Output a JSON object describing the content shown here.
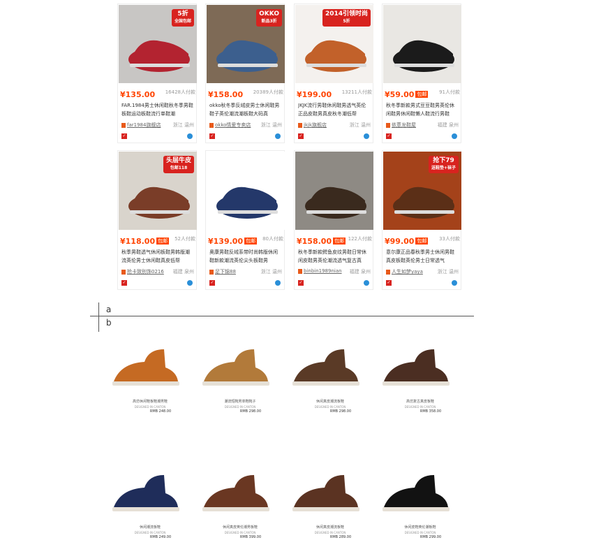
{
  "products": [
    {
      "price": "¥135.00",
      "sold": "16428人付款",
      "badge": "",
      "title": "FAR.1984男士休闲鞋秋冬季男鞋板鞋运动板鞋流行单鞋潮",
      "shop": "far1984旗舰店",
      "loc": "浙江 温州",
      "overlay": "5折",
      "overlay_sub": "全国包邮"
    },
    {
      "price": "¥158.00",
      "sold": "20389人付款",
      "badge": "",
      "title": "okko秋冬季反绒皮男士休闲鞋男鞋子英伦潮流潮板鞋大码真",
      "shop": "okko情爱专卖店",
      "loc": "浙江 温州",
      "overlay": "OKKO",
      "overlay_sub": "新品3折"
    },
    {
      "price": "¥199.00",
      "sold": "13211人付款",
      "badge": "",
      "title": "JKJK流行男鞋休闲鞋男透气英伦正品皮鞋男真皮秋冬潮低帮",
      "shop": "jkjk旗舰店",
      "loc": "浙江 温州",
      "overlay": "2014引领时尚",
      "overlay_sub": "5折"
    },
    {
      "price": "¥59.00",
      "sold": "91人付款",
      "badge": "包邮",
      "title": "秋冬季新款男式豆豆鞋男英伦休闲鞋男休闲鞋懒人鞋流行男鞋",
      "shop": "依蒽龙鞋屋",
      "loc": "福建 泉州",
      "overlay": "",
      "overlay_sub": ""
    },
    {
      "price": "¥118.00",
      "sold": "52人付款",
      "badge": "包邮",
      "title": "秋季男鞋透气休闲板鞋男韩版潮流英伦男士休闲鞋真皮低帮",
      "shop": "抢卡致别饰0216",
      "loc": "福建 泉州",
      "overlay": "头层牛皮",
      "overlay_sub": "包邮118"
    },
    {
      "price": "¥139.00",
      "sold": "80人付款",
      "badge": "包邮",
      "title": "奥康男鞋反绒系带时尚韩版休闲鞋新款潮流英伦尖头板鞋男",
      "shop": "足下锦88",
      "loc": "浙江 温州",
      "overlay": "",
      "overlay_sub": ""
    },
    {
      "price": "¥158.00",
      "sold": "122人付款",
      "badge": "包邮",
      "title": "秋冬季新款鳄鱼皮纹男鞋日常休闲皮鞋男英伦潮流透气复古真",
      "shop": "binbin1989nian",
      "loc": "福建 泉州",
      "overlay": "",
      "overlay_sub": ""
    },
    {
      "price": "¥99.00",
      "sold": "33人付款",
      "badge": "包邮",
      "title": "意尔康正品春秋季男士休闲男鞋真皮板鞋英伦男士日常透气",
      "shop": "人生如梦yaya",
      "loc": "浙江 温州",
      "overlay": "抢下79",
      "overlay_sub": "送鞋垫+袜子"
    }
  ],
  "labels": {
    "a": "a",
    "b": "b"
  },
  "catalog": [
    {
      "name": "高仿休闲鞋板鞋潮男鞋",
      "sub": "DESIGNED IN CANTON",
      "price": "RMB 248.00"
    },
    {
      "name": "潮流短靴男单鞋靴子",
      "sub": "DESIGNED IN CANTON",
      "price": "RMB 298.00"
    },
    {
      "name": "休闲真皮潮流板鞋",
      "sub": "DESIGNED IN CANTON",
      "price": "RMB 298.00"
    },
    {
      "name": "高仿复古真皮板鞋",
      "sub": "DESIGNED IN CANTON",
      "price": "RMB 358.00"
    },
    {
      "name": "休闲潮流板鞋",
      "sub": "DESIGNED IN CANTON",
      "price": "RMB 249.00"
    },
    {
      "name": "休闲真皮英伦潮男板鞋",
      "sub": "DESIGNED IN CANTON",
      "price": "RMB 399.00"
    },
    {
      "name": "休闲真皮潮流板鞋",
      "sub": "DESIGNED IN CANTON",
      "price": "RMB 289.00"
    },
    {
      "name": "休闲皮鞋英伦潮板鞋",
      "sub": "DESIGNED IN CANTON",
      "price": "RMB 299.00"
    }
  ]
}
